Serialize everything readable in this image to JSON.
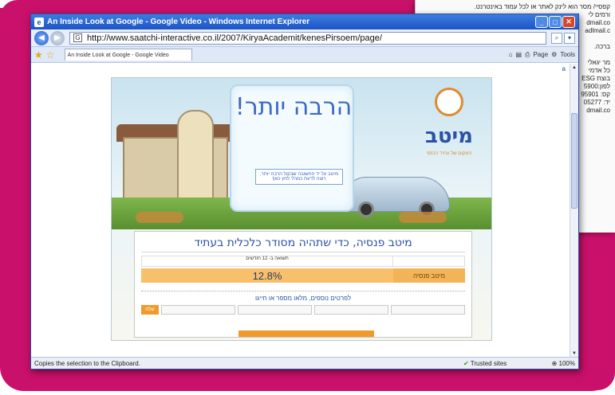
{
  "background_doc": {
    "lines": [
      "קפסיי/ מסר הוא לינק לאתר או לכל עמוד באינטרנט.",
      "ורמים לי",
      "dmail.co",
      "adlmail.c",
      "",
      "ברכה.",
      "",
      "מר יגאלי",
      "כל אדמי",
      "בוצת ESG",
      "לפון:5900",
      "קס: 95901",
      "יד: 05277",
      "dmail.co"
    ]
  },
  "window": {
    "title": "An Inside Look at Google - Google Video - Windows Internet Explorer",
    "url": "http://www.saatchi-interactive.co.il/2007/KiryaAcademit/kenesPirsoem/page/",
    "tab_title": "An Inside Look at Google - Google Video",
    "tools": {
      "page": "Page",
      "tools": "Tools"
    },
    "status_text": "Copies the selection to the Clipboard.",
    "trust_text": "Trusted sites",
    "zoom_text": "100%"
  },
  "ad": {
    "headline": "הרבה יותר!",
    "sub_text": "מיטב על יד החשובה שבקול הרבה יותר, רוצה לדעת כמה? לחץ כאן!",
    "logo_text": "מיטב",
    "logo_tagline": "המקום של עתיד הכסף",
    "panel_title": "מיטב פנסיה, כדי שתהיה מסודר כלכלית בעתיד",
    "yield_header": "תשואה ב- 12 חודשים",
    "fund_label": "מיטב פנסיה",
    "yield_value": "12.8%",
    "contact_text": "לפרטים נוספים, מלאו מספר או חייגו",
    "send_label": "שלח"
  },
  "colors": {
    "magenta": "#c9106a",
    "title_blue": "#1d54c7",
    "ad_blue": "#2a52a5",
    "orange": "#f09a2e"
  }
}
